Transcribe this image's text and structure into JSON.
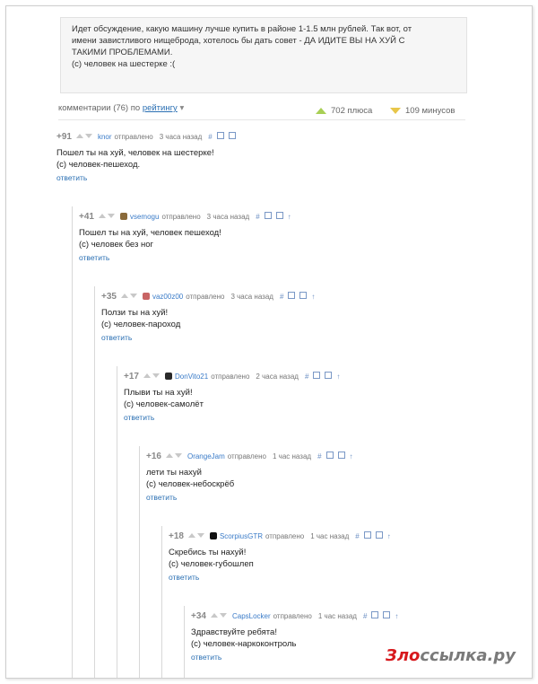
{
  "post": {
    "lines": [
      "Идет обсуждение, какую машину лучше купить в районе 1-1.5 млн рублей. Так вот, от",
      "имени завистливого нищеброда, хотелось бы дать совет - ДА ИДИТЕ ВЫ НА ХУЙ С",
      "ТАКИМИ ПРОБЛЕМАМИ.",
      "(с) человек на шестерке :("
    ]
  },
  "comments_bar": {
    "count_label": "комментарии (76) по",
    "sort_label": "рейтингу",
    "sort_arrow": "▾",
    "plus_label": "702 плюса",
    "minus_label": "109 минусов",
    "plus_color": "#a8cf55",
    "minus_color": "#e8c64a"
  },
  "comments": [
    {
      "score": "+91",
      "author": "knor",
      "posted": "отправлено",
      "time": "3 часа назад",
      "avatar": "",
      "avatar_color": "",
      "lines": [
        "Пошел ты на хуй, человек на шестерке!",
        "(с) человек-пешеход."
      ],
      "reply": "ответить",
      "show_up": false
    },
    {
      "score": "+41",
      "author": "vsemogu",
      "posted": "отправлено",
      "time": "3 часа назад",
      "avatar": "avatar-icon",
      "avatar_color": "#8a6a3a",
      "lines": [
        "Пошел ты на хуй, человек пешеход!",
        "(с) человек без ног"
      ],
      "reply": "ответить",
      "show_up": true
    },
    {
      "score": "+35",
      "author": "vaz00z00",
      "posted": "отправлено",
      "time": "3 часа назад",
      "avatar": "avatar-icon",
      "avatar_color": "#c86464",
      "lines": [
        "Ползи ты на хуй!",
        "(с) человек-пароход"
      ],
      "reply": "ответить",
      "show_up": true
    },
    {
      "score": "+17",
      "author": "DonVito21",
      "posted": "отправлено",
      "time": "2 часа назад",
      "avatar": "avatar-icon",
      "avatar_color": "#2a2a2a",
      "lines": [
        "Плыви ты на хуй!",
        "(с) человек-самолёт"
      ],
      "reply": "ответить",
      "show_up": true
    },
    {
      "score": "+16",
      "author": "OrangeJam",
      "posted": "отправлено",
      "time": "1 час назад",
      "avatar": "",
      "avatar_color": "",
      "lines": [
        "лети ты нахуй",
        "(с) человек-небоскрёб"
      ],
      "reply": "ответить",
      "show_up": true
    },
    {
      "score": "+18",
      "author": "ScorpiusGTR",
      "posted": "отправлено",
      "time": "1 час назад",
      "avatar": "avatar-icon",
      "avatar_color": "#111111",
      "lines": [
        "Скребись ты нахуй!",
        "(с) человек-губошлеп"
      ],
      "reply": "ответить",
      "show_up": true
    },
    {
      "score": "+34",
      "author": "CapsLocker",
      "posted": "отправлено",
      "time": "1 час назад",
      "avatar": "",
      "avatar_color": "",
      "lines": [
        "Здравствуйте ребята!",
        "(с) человек-наркоконтроль"
      ],
      "reply": "ответить",
      "show_up": true
    }
  ],
  "icons": {
    "hash": "#",
    "up_arrow": "↑"
  },
  "watermark": {
    "part1": "Зло",
    "part2": "ссылка.ру"
  }
}
